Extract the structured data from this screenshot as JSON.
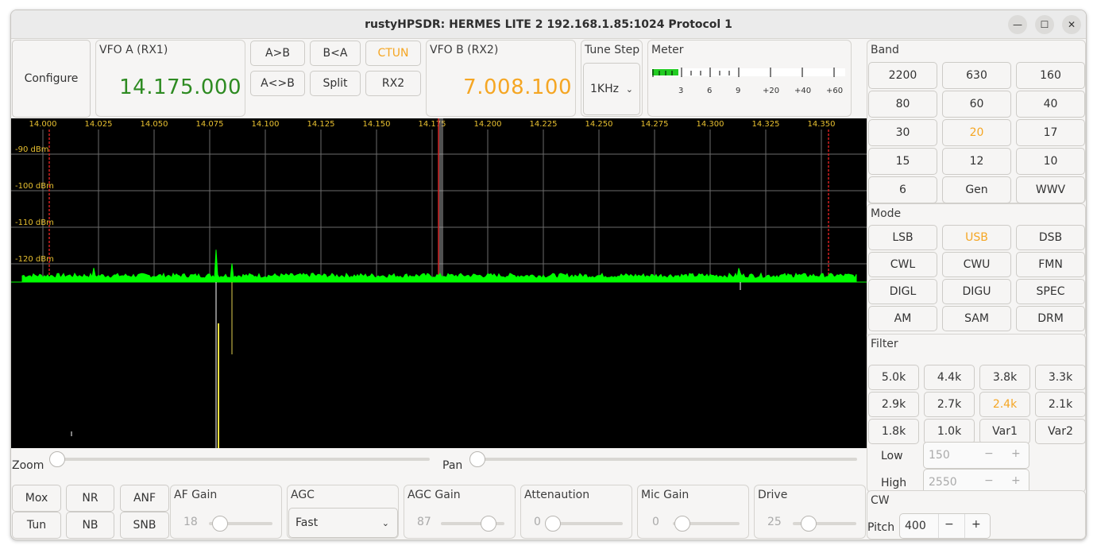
{
  "window": {
    "title": "rustyHPSDR: HERMES LITE 2 192.168.1.85:1024 Protocol 1",
    "minimize_icon": "minimize-icon",
    "maximize_icon": "maximize-icon",
    "close_icon": "close-icon"
  },
  "toolbar": {
    "configure": "Configure",
    "vfo_a_label": "VFO A (RX1)",
    "vfo_a_freq": "14.175.000",
    "vfo_b_label": "VFO B (RX2)",
    "vfo_b_freq": "7.008.100",
    "a_to_b": "A>B",
    "b_to_a": "B<A",
    "ctun": "CTUN",
    "a_swap_b": "A<>B",
    "split": "Split",
    "rx2": "RX2",
    "tune_step_label": "Tune Step",
    "tune_step_value": "1KHz",
    "meter_label": "Meter",
    "meter_ticks": [
      "3",
      "6",
      "9",
      "+20",
      "+40",
      "+60"
    ]
  },
  "colors": {
    "vfo_a": "#2e8b22",
    "vfo_b": "#f5a623",
    "active": "#f5a623",
    "spectrum": "#00ff00",
    "grid_label": "#e8c030",
    "marker": "#d02020"
  },
  "panadapter": {
    "freq_labels": [
      "14.000",
      "14.025",
      "14.050",
      "14.075",
      "14.100",
      "14.125",
      "14.150",
      "14.175",
      "14.200",
      "14.225",
      "14.250",
      "14.275",
      "14.300",
      "14.325",
      "14.350"
    ],
    "dbm_labels": [
      "-90 dBm",
      "-100 dBm",
      "-110 dBm",
      "-120 dBm"
    ]
  },
  "sliders": {
    "zoom_label": "Zoom",
    "pan_label": "Pan"
  },
  "bottom": {
    "mox": "Mox",
    "tun": "Tun",
    "nr": "NR",
    "nb": "NB",
    "anf": "ANF",
    "snb": "SNB",
    "af_gain_label": "AF Gain",
    "af_gain_value": "18",
    "agc_label": "AGC",
    "agc_value": "Fast",
    "agc_gain_label": "AGC Gain",
    "agc_gain_value": "87",
    "atten_label": "Attenaution",
    "atten_value": "0",
    "mic_gain_label": "Mic Gain",
    "mic_gain_value": "0",
    "drive_label": "Drive",
    "drive_value": "25"
  },
  "band": {
    "label": "Band",
    "items": [
      "2200",
      "630",
      "160",
      "80",
      "60",
      "40",
      "30",
      "20",
      "17",
      "15",
      "12",
      "10",
      "6",
      "Gen",
      "WWV"
    ],
    "active": "20"
  },
  "mode": {
    "label": "Mode",
    "items": [
      "LSB",
      "USB",
      "DSB",
      "CWL",
      "CWU",
      "FMN",
      "DIGL",
      "DIGU",
      "SPEC",
      "AM",
      "SAM",
      "DRM"
    ],
    "active": "USB"
  },
  "filter": {
    "label": "Filter",
    "items": [
      "5.0k",
      "4.4k",
      "3.8k",
      "3.3k",
      "2.9k",
      "2.7k",
      "2.4k",
      "2.1k",
      "1.8k",
      "1.0k",
      "Var1",
      "Var2"
    ],
    "active": "2.4k",
    "low_label": "Low",
    "low_value": "150",
    "high_label": "High",
    "high_value": "2550"
  },
  "cw": {
    "label": "CW",
    "pitch_label": "Pitch",
    "pitch_value": "400",
    "minus": "−",
    "plus": "+"
  }
}
